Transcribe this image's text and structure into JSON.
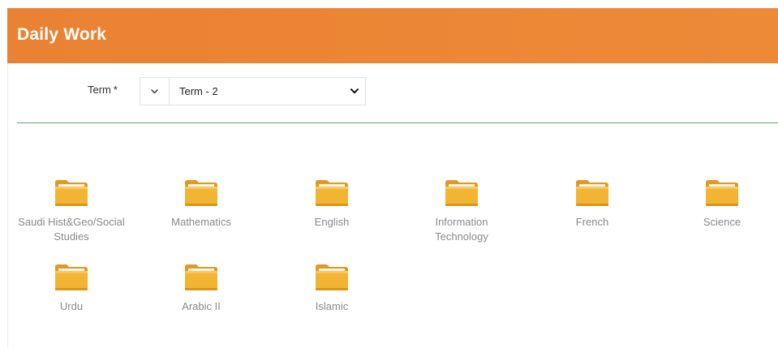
{
  "header": {
    "title": "Daily Work"
  },
  "term": {
    "label": "Term",
    "required_marker": "*",
    "selected": "Term - 2",
    "addon_icon": "chevron-down-icon"
  },
  "folders": [
    {
      "label": "Saudi Hist&Geo/Social Studies",
      "icon": "folder-icon"
    },
    {
      "label": "Mathematics",
      "icon": "folder-icon"
    },
    {
      "label": "English",
      "icon": "folder-icon"
    },
    {
      "label": "Information Technology",
      "icon": "folder-icon"
    },
    {
      "label": "French",
      "icon": "folder-icon"
    },
    {
      "label": "Science",
      "icon": "folder-icon"
    },
    {
      "label": "Urdu",
      "icon": "folder-icon"
    },
    {
      "label": "Arabic II",
      "icon": "folder-icon"
    },
    {
      "label": "Islamic",
      "icon": "folder-icon"
    }
  ],
  "colors": {
    "header": "#ea8233",
    "divider": "#6aa36a",
    "folder": "#f2b533",
    "label": "#8a8a8a"
  }
}
